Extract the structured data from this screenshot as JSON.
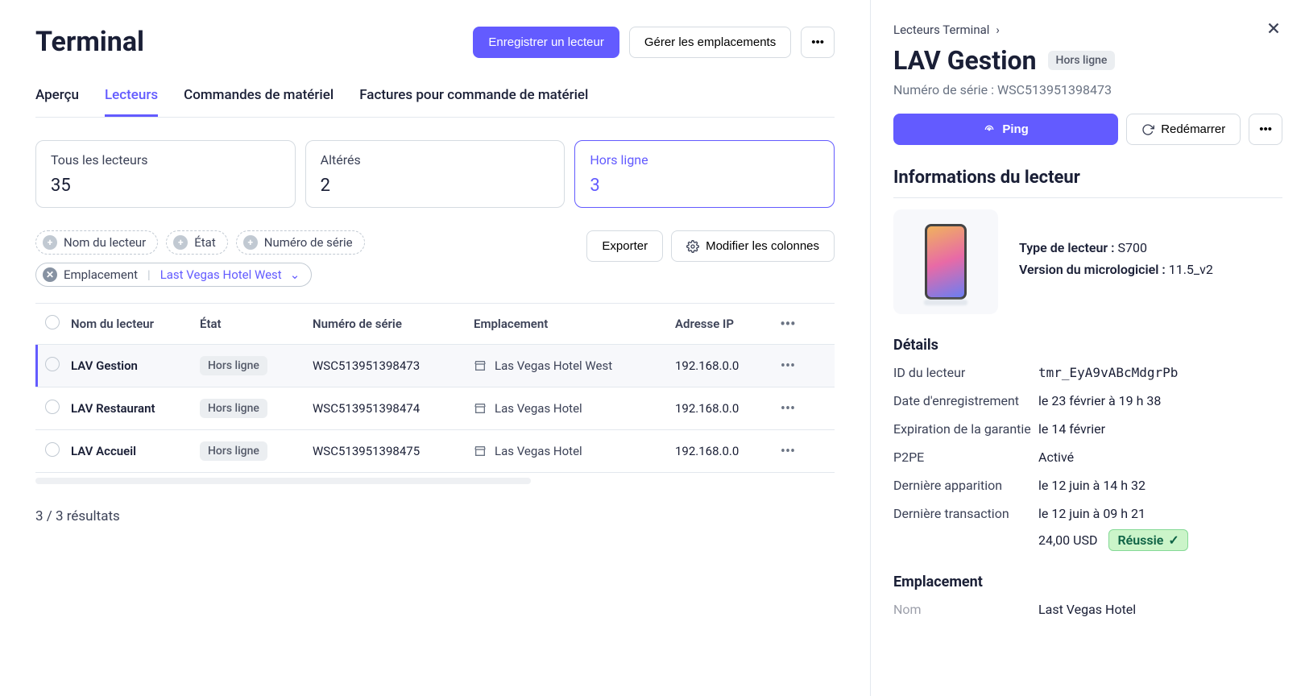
{
  "header": {
    "title": "Terminal",
    "register_btn": "Enregistrer un lecteur",
    "manage_btn": "Gérer les emplacements"
  },
  "tabs": [
    {
      "label": "Aperçu",
      "active": false
    },
    {
      "label": "Lecteurs",
      "active": true
    },
    {
      "label": "Commandes de matériel",
      "active": false
    },
    {
      "label": "Factures pour commande de matériel",
      "active": false
    }
  ],
  "stats": [
    {
      "label": "Tous les lecteurs",
      "value": "35",
      "active": false
    },
    {
      "label": "Altérés",
      "value": "2",
      "active": false
    },
    {
      "label": "Hors ligne",
      "value": "3",
      "active": true
    }
  ],
  "filters": {
    "chips": {
      "name": "Nom du lecteur",
      "status": "État",
      "serial": "Numéro de série",
      "location_label": "Emplacement",
      "location_value": "Last Vegas Hotel West"
    },
    "export_btn": "Exporter",
    "columns_btn": "Modifier les colonnes"
  },
  "table": {
    "headers": {
      "name": "Nom du lecteur",
      "status": "État",
      "serial": "Numéro de série",
      "location": "Emplacement",
      "ip": "Adresse IP"
    },
    "rows": [
      {
        "name": "LAV Gestion",
        "status": "Hors ligne",
        "serial": "WSC513951398473",
        "location": "Las Vegas Hotel West",
        "ip": "192.168.0.0",
        "selected": true
      },
      {
        "name": "LAV Restaurant",
        "status": "Hors ligne",
        "serial": "WSC513951398474",
        "location": "Las Vegas Hotel",
        "ip": "192.168.0.0",
        "selected": false
      },
      {
        "name": "LAV Accueil",
        "status": "Hors ligne",
        "serial": "WSC513951398475",
        "location": "Las Vegas Hotel",
        "ip": "192.168.0.0",
        "selected": false
      }
    ],
    "results": "3 / 3 résultats"
  },
  "panel": {
    "breadcrumb": "Lecteurs Terminal",
    "title": "LAV Gestion",
    "status": "Hors ligne",
    "serial_label": "Numéro de série :",
    "serial_value": "WSC513951398473",
    "ping_btn": "Ping",
    "restart_btn": "Redémarrer",
    "info_heading": "Informations du lecteur",
    "type_label": "Type de lecteur :",
    "type_value": "S700",
    "fw_label": "Version du micrologiciel :",
    "fw_value": "11.5_v2",
    "details_heading": "Détails",
    "details": {
      "reader_id_label": "ID du lecteur",
      "reader_id_value": "tmr_EyA9vABcMdgrPb",
      "reg_label": "Date d'enregistrement",
      "reg_value": "le 23 février à 19 h 38",
      "warranty_label": "Expiration de la garantie",
      "warranty_value": "le 14 février",
      "p2pe_label": "P2PE",
      "p2pe_value": "Activé",
      "last_seen_label": "Dernière apparition",
      "last_seen_value": "le 12 juin à 14 h 32",
      "last_tx_label": "Dernière transaction",
      "last_tx_value": "le 12 juin à 09 h 21",
      "last_tx_amount": "24,00 USD",
      "last_tx_status": "Réussie"
    },
    "location_heading": "Emplacement",
    "location_value": "Last Vegas Hotel"
  }
}
